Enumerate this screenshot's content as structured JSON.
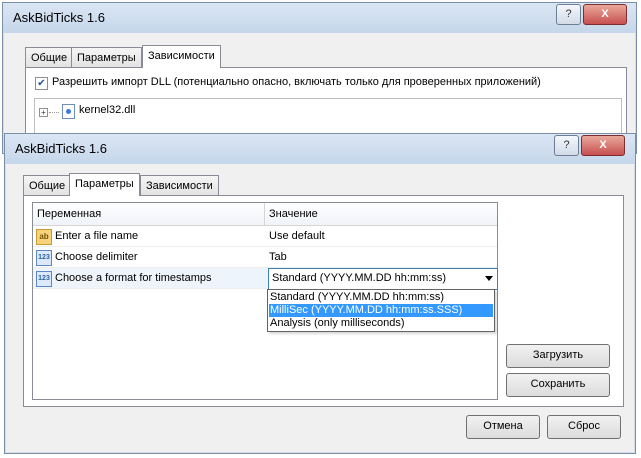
{
  "back_window": {
    "title": "AskBidTicks 1.6",
    "buttons": {
      "help": "?",
      "close": "X"
    },
    "tabs": [
      "Общие",
      "Параметры",
      "Зависимости"
    ],
    "active_tab": "Зависимости",
    "dll_checkbox_label": "Разрешить импорт DLL (потенциально опасно, включать только для проверенных приложений)",
    "dll_checked": true,
    "tree_item": "kernel32.dll"
  },
  "front_window": {
    "title": "AskBidTicks 1.6",
    "buttons": {
      "help": "?",
      "close": "X"
    },
    "tabs": [
      "Общие",
      "Параметры",
      "Зависимости"
    ],
    "active_tab": "Параметры",
    "grid": {
      "headers": [
        "Переменная",
        "Значение"
      ],
      "rows": [
        {
          "icon": "ab",
          "name": "Enter a file name",
          "value": "Use default"
        },
        {
          "icon": "123",
          "name": "Choose delimiter",
          "value": "Tab"
        },
        {
          "icon": "123",
          "name": "Choose a format for timestamps",
          "value": "Standard  (YYYY.MM.DD hh:mm:ss)"
        }
      ]
    },
    "dropdown_options": [
      "Standard  (YYYY.MM.DD hh:mm:ss)",
      "MilliSec  (YYYY.MM.DD hh:mm:ss.SSS)",
      "Analysis  (only milliseconds)"
    ],
    "dropdown_highlighted_index": 1,
    "side_buttons": {
      "load": "Загрузить",
      "save": "Сохранить"
    },
    "footer_buttons": {
      "cancel": "Отмена",
      "reset": "Сброс"
    }
  }
}
